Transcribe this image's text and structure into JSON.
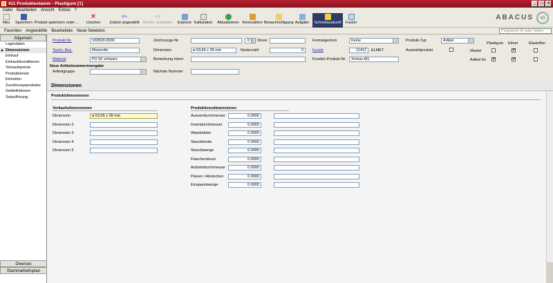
{
  "window": {
    "title": "411 Produktestamm - Plastigum [1]",
    "buttons": [
      "_",
      "□",
      "×"
    ]
  },
  "menu": [
    "Datei",
    "Bearbeiten",
    "Ansicht",
    "Extras",
    "?"
  ],
  "toolbar": [
    "Neu",
    "Speichern",
    "Produkt speichern unter ...",
    "Löschen",
    "Zuletzt angewählt",
    "Wieder anwählen",
    "Explorer",
    "Kalkulation",
    "Aktualisieren",
    "Kennzahlen",
    "Benachrichtigung",
    "Aufgabe",
    "Schnellauskunft",
    "Fusion"
  ],
  "brand": {
    "name": "ABACUS",
    "logo": "vi"
  },
  "subbar": [
    "Favoriten",
    "Angewählte",
    "Bearbeitete",
    "Neue Selektion"
  ],
  "search_placeholder": "Programm ID oder Name",
  "sidebar": {
    "top_tab": "Allgemein",
    "items": [
      "Lagerdaten",
      "Dimensionen",
      "Einkauf",
      "Einkaufskonditionen",
      "Verkaufspreise",
      "Produktetexte",
      "Einheiten",
      "Zuordnungsprodukte",
      "Setdefinitionen",
      "Setauflösung"
    ],
    "selected": 1,
    "bottom_tabs": [
      "Diverses",
      "Stammarbeitsplan"
    ]
  },
  "header": {
    "produkt_nr": {
      "label": "Produkt-Nr.",
      "value": "V00520.0000"
    },
    "techn_bez": {
      "label": "Techn. Bez.",
      "value": "Messrolle"
    },
    "material": {
      "label": "Material",
      "value": "PU 92 schwarz"
    },
    "neue_nummer": "Neue Artikelnummernvergabe",
    "artikelgruppe": "Artikelgruppe",
    "zeichnungs_nr": {
      "label": "Zeichnungs-Nr.",
      "index": "0",
      "shore_label": "Shore"
    },
    "dimension": {
      "label": "Dimension",
      "value": "ø 63,66 x 28 mm",
      "nesterzahl_label": "Nesterzahl",
      "nesterzahl": "0"
    },
    "bemerkung": "Bemerkung intern",
    "naechste_nummer": "Nächste Nummer",
    "formeigentum": {
      "label": "Formeigentum",
      "value": "Keine"
    },
    "kunde": {
      "label": "Kunde",
      "nr": "11412",
      "name": "ELMET"
    },
    "kunden_produkt": {
      "label": "Kunden-Produkt-Nr.",
      "value": "Xomax AG"
    },
    "produkt_typ": {
      "label": "Produkt-Typ",
      "value": "Artikel"
    },
    "auswahlprodukt": "Auswahlprodukt",
    "matrix": {
      "columns": [
        "Plastigum",
        "Elmet",
        "Elastoflon"
      ],
      "rows": [
        {
          "label": "Master",
          "checks": [
            false,
            true,
            false
          ]
        },
        {
          "label": "Artikel für",
          "checks": [
            true,
            true,
            false
          ]
        }
      ]
    }
  },
  "section": {
    "title": "Dimensionen",
    "subtitle": "Produktdimensionen"
  },
  "verkauf": {
    "title": "Verkaufsdimensionen",
    "rows": [
      {
        "label": "Dimension",
        "value": "ø 63,66 x 28 mm"
      },
      {
        "label": "Dimension 2",
        "value": ""
      },
      {
        "label": "Dimension 3",
        "value": ""
      },
      {
        "label": "Dimension 4",
        "value": ""
      },
      {
        "label": "Dimension 5",
        "value": ""
      }
    ]
  },
  "produktion": {
    "title": "Produktionsdimensionen",
    "rows": [
      {
        "label": "Aussendurchmesser",
        "value": "0.0000"
      },
      {
        "label": "Innendurchmesser",
        "value": "0.0000"
      },
      {
        "label": "Wandstärke",
        "value": "0.0000"
      },
      {
        "label": "Stueckbreite",
        "value": "0.0000"
      },
      {
        "label": "Stuecklaenge",
        "value": "0.0000"
      },
      {
        "label": "Flaechendruck",
        "value": "0.0000"
      },
      {
        "label": "Aufziehdurchmesser",
        "value": "0.0000"
      },
      {
        "label": "Planen / Abstechen",
        "value": "0.0000"
      },
      {
        "label": "Einspannlaenge",
        "value": "0.0000"
      }
    ]
  }
}
